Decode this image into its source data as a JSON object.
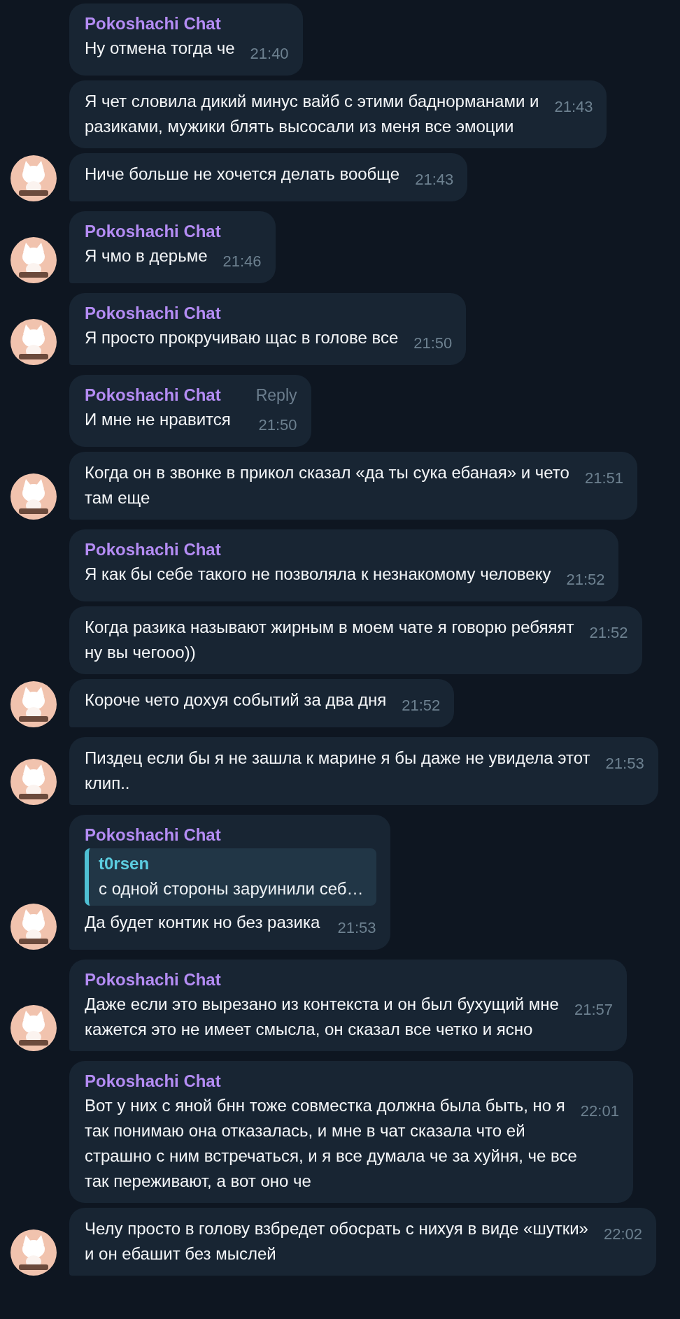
{
  "messages": [
    {
      "name": "Pokoshachi Chat",
      "text": "Ну отмена тогда че",
      "time": "21:40",
      "avatar": false
    },
    {
      "text": "Я чет словила дикий минус вайб с этими баднорманами и\nразиками, мужики блять высосали из меня все эмоции",
      "time": "21:43",
      "avatar": false
    },
    {
      "text": "Ниче больше не хочется делать вообще",
      "time": "21:43",
      "avatar": true
    },
    {
      "name": "Pokoshachi Chat",
      "text": "Я чмо в дерьме",
      "time": "21:46",
      "avatar": true
    },
    {
      "name": "Pokoshachi Chat",
      "text": "Я просто прокручиваю щас в голове все",
      "time": "21:50",
      "avatar": true
    },
    {
      "name": "Pokoshachi Chat",
      "reply_button": "Reply",
      "text": "И мне не нравится",
      "time": "21:50",
      "avatar": false
    },
    {
      "text": "Когда он в звонке в прикол сказал «да ты сука ебаная» и чето\nтам еще",
      "time": "21:51",
      "avatar": true
    },
    {
      "name": "Pokoshachi Chat",
      "text": "Я как бы себе такого не позволяла к незнакомому человеку",
      "time": "21:52",
      "avatar": false
    },
    {
      "text": "Когда разика называют жирным в моем чате я говорю ребяяят\nну вы чегооо))",
      "time": "21:52",
      "avatar": false
    },
    {
      "text": "Короче чето дохуя событий за два дня",
      "time": "21:52",
      "avatar": true
    },
    {
      "text": "Пиздец если бы я не зашла к марине я бы даже не увидела этот\nклип..",
      "time": "21:53",
      "avatar": true
    },
    {
      "name": "Pokoshachi Chat",
      "quote": {
        "author": "t0rsen",
        "text": "с одной стороны заруинили себ…"
      },
      "text": "Да будет контик но без разика",
      "time": "21:53",
      "avatar": true
    },
    {
      "name": "Pokoshachi Chat",
      "text": "Даже если это вырезано из контекста и он был бухущий мне\nкажется это не имеет смысла, он сказал все четко и ясно",
      "time": "21:57",
      "avatar": true
    },
    {
      "name": "Pokoshachi Chat",
      "text": "Вот у них с яной бнн тоже совместка должна была быть, но я\nтак понимаю она отказалась, и мне в чат сказала что ей\nстрашно с ним встречаться, и я все думала че за хуйня, че все\nтак переживают, а вот оно че",
      "time": "22:01",
      "avatar": false
    },
    {
      "text": "Челу просто в голову взбредет обосрать с нихуя в виде «шутки»\nи он ебашит без мыслей",
      "time": "22:02",
      "avatar": true
    }
  ]
}
